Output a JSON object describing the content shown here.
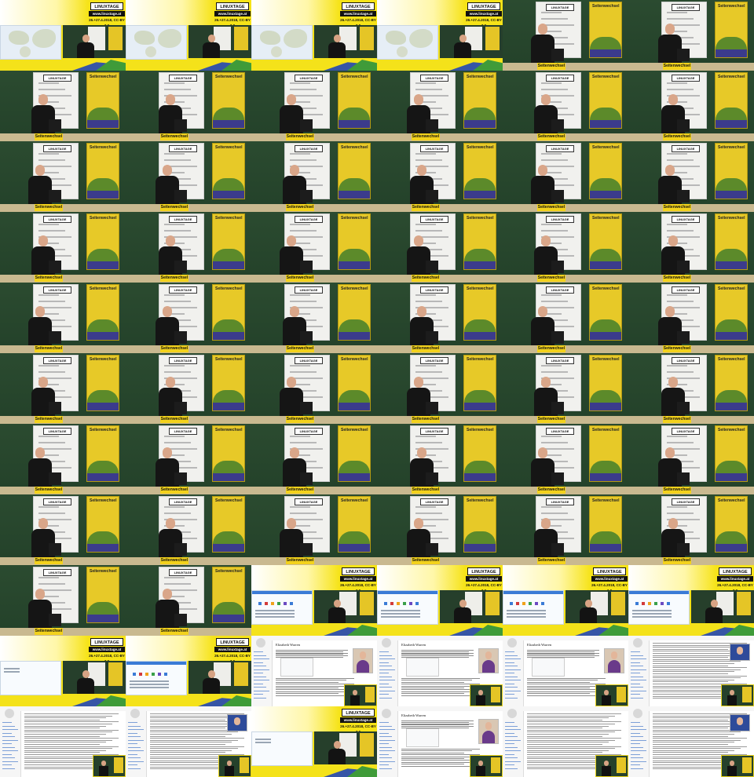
{
  "contact_sheet": {
    "columns": 6,
    "rows": 11,
    "frame_texts": {
      "logo": "LINUXTAGE",
      "url": "www.linuxtage.at",
      "dates": "26.+27.4.2018, CC-BY 3.0",
      "sign": "Seitenwechsel",
      "wiki_title": "Elizabeth Warren"
    },
    "frame_sequence": [
      "slide-map",
      "slide-map",
      "slide-map",
      "slide-map",
      "stage",
      "stage",
      "stage",
      "stage",
      "stage",
      "stage",
      "stage",
      "stage",
      "stage",
      "stage",
      "stage",
      "stage",
      "stage",
      "stage",
      "stage",
      "stage",
      "stage",
      "stage",
      "stage",
      "stage",
      "stage",
      "stage",
      "stage",
      "stage",
      "stage",
      "stage",
      "stage",
      "stage",
      "stage",
      "stage",
      "stage",
      "stage",
      "stage",
      "stage",
      "stage",
      "stage",
      "stage",
      "stage",
      "stage",
      "stage",
      "stage",
      "stage",
      "stage",
      "stage",
      "stage",
      "stage",
      "slide-web",
      "slide-web",
      "slide-web",
      "slide-web",
      "slide-blank",
      "slide-web",
      "wiki-top",
      "wiki-top",
      "wiki-top",
      "wiki-dense",
      "wiki-dense",
      "wiki-dense",
      "slide-blank",
      "wiki-top",
      "wiki-dense",
      "wiki-dense"
    ],
    "colors": {
      "broadcast_yellow": "#f4e21a",
      "chalkboard_green": "#24442b",
      "wiki_background": "#f6f6f6"
    }
  }
}
